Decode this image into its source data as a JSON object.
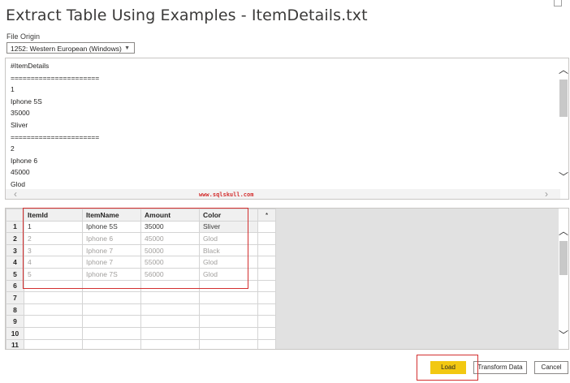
{
  "window": {
    "title": "Extract Table Using Examples - ItemDetails.txt"
  },
  "file_origin": {
    "label": "File Origin",
    "value": "1252: Western European (Windows)"
  },
  "preview": {
    "lines": [
      "#ItemDetails",
      "======================",
      "1",
      "Iphone 5S",
      "35000",
      "Sliver",
      "======================",
      "2",
      "Iphone 6",
      "45000",
      "Glod"
    ]
  },
  "watermark": "www.sqlskull.com",
  "grid": {
    "columns": [
      "ItemId",
      "ItemName",
      "Amount",
      "Color"
    ],
    "add_column": "*",
    "rows": [
      {
        "n": "1",
        "cells": [
          "1",
          "Iphone 5S",
          "35000",
          "Sliver"
        ],
        "kind": "user"
      },
      {
        "n": "2",
        "cells": [
          "2",
          "Iphone 6",
          "45000",
          "Glod"
        ],
        "kind": "sample"
      },
      {
        "n": "3",
        "cells": [
          "3",
          "Iphone 7",
          "50000",
          "Black"
        ],
        "kind": "sample"
      },
      {
        "n": "4",
        "cells": [
          "4",
          "Iphone 7",
          "55000",
          "Glod"
        ],
        "kind": "sample"
      },
      {
        "n": "5",
        "cells": [
          "5",
          "Iphone 7S",
          "56000",
          "Glod"
        ],
        "kind": "sample"
      },
      {
        "n": "6",
        "cells": [
          "",
          "",
          "",
          ""
        ],
        "kind": "empty"
      },
      {
        "n": "7",
        "cells": [
          "",
          "",
          "",
          ""
        ],
        "kind": "empty"
      },
      {
        "n": "8",
        "cells": [
          "",
          "",
          "",
          ""
        ],
        "kind": "empty"
      },
      {
        "n": "9",
        "cells": [
          "",
          "",
          "",
          ""
        ],
        "kind": "empty"
      },
      {
        "n": "10",
        "cells": [
          "",
          "",
          "",
          ""
        ],
        "kind": "empty"
      },
      {
        "n": "11",
        "cells": [
          "",
          "",
          "",
          ""
        ],
        "kind": "empty"
      }
    ]
  },
  "buttons": {
    "load": "Load",
    "transform": "Transform Data",
    "cancel": "Cancel"
  },
  "colors": {
    "accent_load": "#f2c811",
    "highlight": "#d32f2f"
  }
}
